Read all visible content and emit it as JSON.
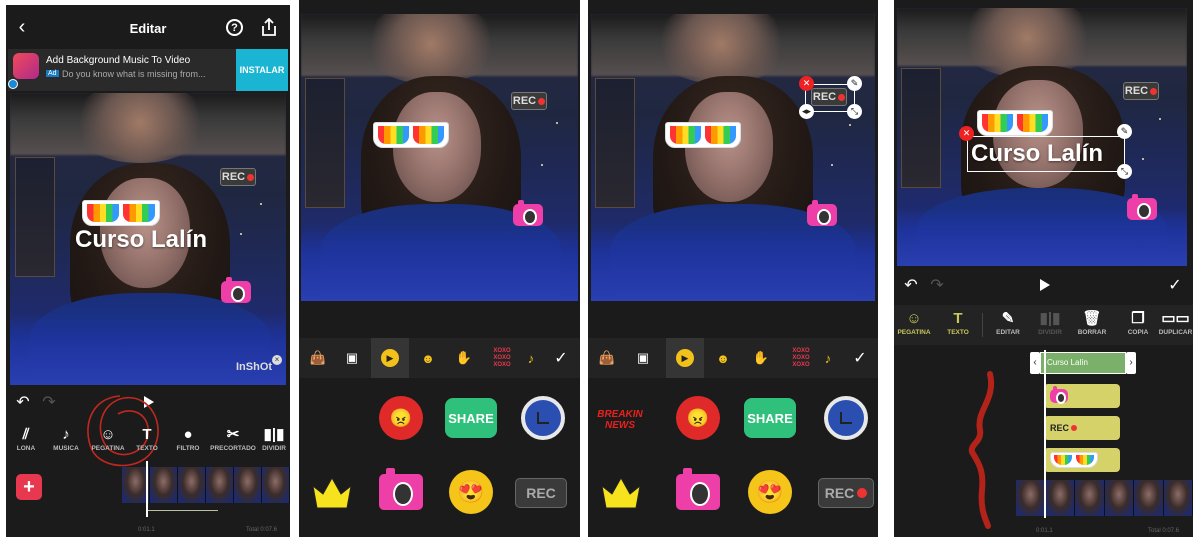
{
  "panel1": {
    "header": {
      "title": "Editar",
      "back_icon": "chevron-left",
      "help_icon": "?",
      "share_icon": "share"
    },
    "ad": {
      "title": "Add Background Music To Video",
      "badge": "Ad",
      "subtitle": "Do you know what is missing from...",
      "install_label": "INSTALAR"
    },
    "video_text": "Curso Lalín",
    "watermark": "InShOt",
    "tools": [
      {
        "icon": "lona-icon",
        "label": "LONA"
      },
      {
        "icon": "music-icon",
        "label": "MUSICA"
      },
      {
        "icon": "sticker-icon",
        "label": "PEGATINA"
      },
      {
        "icon": "text-icon",
        "label": "TEXTO"
      },
      {
        "icon": "filter-icon",
        "label": "FILTRO"
      },
      {
        "icon": "scissors-icon",
        "label": "PRECORTADO"
      },
      {
        "icon": "split-icon",
        "label": "DIVIDIR"
      }
    ],
    "time_current": "0:01.1",
    "time_total": "Total 0:07.6"
  },
  "sticker_tabs": [
    "bag-icon",
    "image-icon",
    "play-icon",
    "grin-icon",
    "hand-icon",
    "xoxo-icon",
    "music-note-icon"
  ],
  "panel2": {
    "stickers": [
      {
        "name": "angry-face-sticker"
      },
      {
        "name": "share-sticker",
        "text": "SHARE"
      },
      {
        "name": "clock-sticker"
      },
      {
        "name": "crown-sticker"
      },
      {
        "name": "camera-sticker"
      },
      {
        "name": "heart-eyes-sticker"
      },
      {
        "name": "rec-sticker",
        "text": "REC"
      }
    ]
  },
  "panel3": {
    "stickers": [
      {
        "name": "breaking-news-sticker",
        "text": "BREAKIN NEWS"
      },
      {
        "name": "angry-face-sticker"
      },
      {
        "name": "share-sticker",
        "text": "SHARE"
      },
      {
        "name": "clock-sticker"
      },
      {
        "name": "crown-sticker"
      },
      {
        "name": "camera-sticker"
      },
      {
        "name": "heart-eyes-sticker"
      },
      {
        "name": "rec-sticker",
        "text": "REC"
      }
    ]
  },
  "panel4": {
    "video_text": "Curso Lalín",
    "tools": [
      {
        "icon": "sticker-add-icon",
        "label": "PEGATINA",
        "color": "#c8c85a"
      },
      {
        "icon": "text-add-icon",
        "label": "TEXTO",
        "color": "#c8c85a"
      },
      {
        "icon": "pencil-icon",
        "label": "EDITAR",
        "color": "#888"
      },
      {
        "icon": "split-icon",
        "label": "DIVIDIR",
        "color": "#555"
      },
      {
        "icon": "trash-icon",
        "label": "BORRAR",
        "color": "#888"
      },
      {
        "icon": "copy-icon",
        "label": "COPIA",
        "color": "#888"
      },
      {
        "icon": "duplicate-icon",
        "label": "DUPLICAR",
        "color": "#888"
      }
    ],
    "tracks": [
      {
        "name": "text-track",
        "label": "Curso Lalín"
      },
      {
        "name": "camera-track"
      },
      {
        "name": "rec-track",
        "label": "REC"
      },
      {
        "name": "glasses-track"
      }
    ],
    "time_current": "0:01.1",
    "time_total": "Total 0:07.6"
  },
  "colors": {
    "accent_red": "#e8384f",
    "selection_green": "#7ab06a",
    "ad_cyan": "#19b5d3",
    "track_yellow": "#d6d26a"
  }
}
